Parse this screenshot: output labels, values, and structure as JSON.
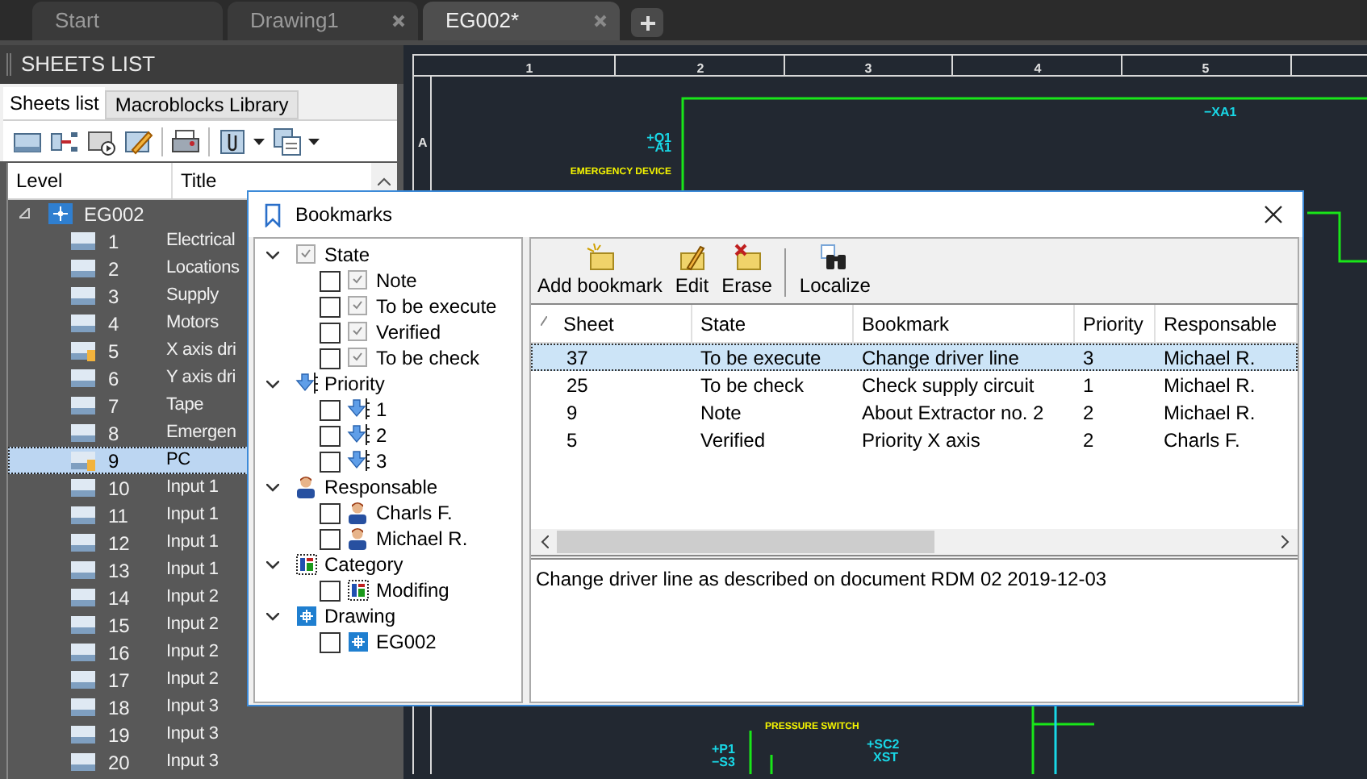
{
  "doc_tabs": [
    {
      "label": "Start",
      "selected": false,
      "closable": false
    },
    {
      "label": "Drawing1",
      "selected": false,
      "closable": true
    },
    {
      "label": "EG002*",
      "selected": true,
      "closable": true
    }
  ],
  "sheets_panel": {
    "title": "SHEETS LIST",
    "tabs": [
      {
        "label": "Sheets list",
        "selected": true
      },
      {
        "label": "Macroblocks Library",
        "selected": false
      }
    ],
    "columns": [
      "Level",
      "Title"
    ],
    "tree": {
      "label": "EG002",
      "expanded": true,
      "children": [
        {
          "number": "1",
          "title": "Electrical",
          "bookmarked": false,
          "selected": false
        },
        {
          "number": "2",
          "title": "Locations",
          "bookmarked": false,
          "selected": false
        },
        {
          "number": "3",
          "title": "Supply",
          "bookmarked": false,
          "selected": false
        },
        {
          "number": "4",
          "title": "Motors",
          "bookmarked": false,
          "selected": false
        },
        {
          "number": "5",
          "title": "X axis dri",
          "bookmarked": true,
          "selected": false
        },
        {
          "number": "6",
          "title": "Y axis dri",
          "bookmarked": false,
          "selected": false
        },
        {
          "number": "7",
          "title": "Tape",
          "bookmarked": false,
          "selected": false
        },
        {
          "number": "8",
          "title": "Emergen",
          "bookmarked": false,
          "selected": false
        },
        {
          "number": "9",
          "title": "PC",
          "bookmarked": true,
          "selected": true
        },
        {
          "number": "10",
          "title": "Input 1",
          "bookmarked": false,
          "selected": false
        },
        {
          "number": "11",
          "title": "Input 1",
          "bookmarked": false,
          "selected": false
        },
        {
          "number": "12",
          "title": "Input 1",
          "bookmarked": false,
          "selected": false
        },
        {
          "number": "13",
          "title": "Input 1",
          "bookmarked": false,
          "selected": false
        },
        {
          "number": "14",
          "title": "Input 2",
          "bookmarked": false,
          "selected": false
        },
        {
          "number": "15",
          "title": "Input 2",
          "bookmarked": false,
          "selected": false
        },
        {
          "number": "16",
          "title": "Input 2",
          "bookmarked": false,
          "selected": false
        },
        {
          "number": "17",
          "title": "Input 2",
          "bookmarked": false,
          "selected": false
        },
        {
          "number": "18",
          "title": "Input 3",
          "bookmarked": false,
          "selected": false
        },
        {
          "number": "19",
          "title": "Input 3",
          "bookmarked": false,
          "selected": false
        },
        {
          "number": "20",
          "title": "Input 3",
          "bookmarked": false,
          "selected": false
        }
      ]
    }
  },
  "canvas": {
    "column_numbers": [
      "1",
      "2",
      "3",
      "4",
      "5"
    ],
    "row_letter": "A",
    "labels": [
      {
        "text": "+Q1",
        "kind": "tag"
      },
      {
        "text": "−A1",
        "kind": "tag"
      },
      {
        "text": "EMERGENCY DEVICE",
        "kind": "note"
      },
      {
        "text": "−XA1",
        "kind": "tag"
      },
      {
        "text": "PRESSURE SWITCH",
        "kind": "note"
      },
      {
        "text": "+P1",
        "kind": "tag"
      },
      {
        "text": "−S3",
        "kind": "tag"
      },
      {
        "text": "+SC2",
        "kind": "tag"
      },
      {
        "text": "XST",
        "kind": "tag"
      }
    ]
  },
  "dialog": {
    "title": "Bookmarks",
    "filters": [
      {
        "label": "State",
        "kind": "state",
        "expanded": true,
        "children": [
          {
            "label": "Note",
            "checked": false
          },
          {
            "label": "To be execute",
            "checked": false
          },
          {
            "label": "Verified",
            "checked": false
          },
          {
            "label": "To be check",
            "checked": false
          }
        ]
      },
      {
        "label": "Priority",
        "kind": "priority",
        "expanded": true,
        "children": [
          {
            "label": "1",
            "checked": false
          },
          {
            "label": "2",
            "checked": false
          },
          {
            "label": "3",
            "checked": false
          }
        ]
      },
      {
        "label": "Responsable",
        "kind": "person",
        "expanded": true,
        "children": [
          {
            "label": "Charls F.",
            "checked": false
          },
          {
            "label": "Michael R.",
            "checked": false
          }
        ]
      },
      {
        "label": "Category",
        "kind": "category",
        "expanded": true,
        "children": [
          {
            "label": "Modifing",
            "checked": false
          }
        ]
      },
      {
        "label": "Drawing",
        "kind": "drawing",
        "expanded": true,
        "children": [
          {
            "label": "EG002",
            "checked": false
          }
        ]
      }
    ],
    "toolbar": [
      {
        "label": "Add bookmark",
        "kind": "add"
      },
      {
        "label": "Edit",
        "kind": "edit"
      },
      {
        "label": "Erase",
        "kind": "erase"
      },
      {
        "label": "Localize",
        "kind": "localize"
      }
    ],
    "table": {
      "columns": [
        "Sheet",
        "State",
        "Bookmark",
        "Priority",
        "Responsable"
      ],
      "rows": [
        {
          "cells": [
            "37",
            "To be execute",
            "Change driver line",
            "3",
            "Michael R."
          ],
          "selected": true
        },
        {
          "cells": [
            "25",
            "To be check",
            "Check supply circuit",
            "1",
            "Michael R."
          ],
          "selected": false
        },
        {
          "cells": [
            "9",
            "Note",
            "About Extractor no. 2",
            "2",
            "Michael R."
          ],
          "selected": false
        },
        {
          "cells": [
            "5",
            "Verified",
            "Priority X axis",
            "2",
            "Charls F."
          ],
          "selected": false
        }
      ]
    },
    "description": "Change driver line as described on document RDM 02 2019-12-03"
  }
}
